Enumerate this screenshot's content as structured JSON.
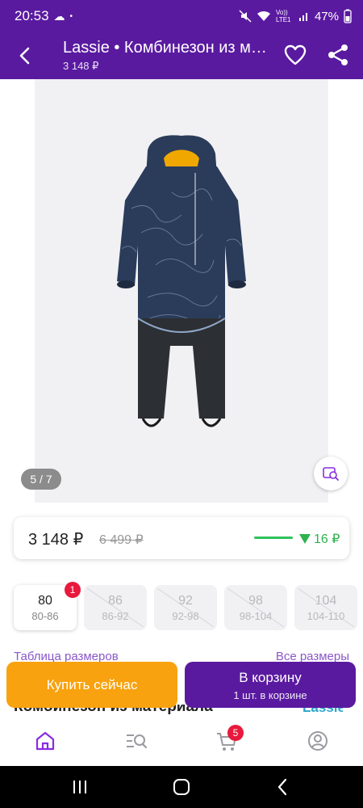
{
  "status_bar": {
    "time": "20:53",
    "network_label": "Vo)) LTE1",
    "battery": "47%"
  },
  "app_bar": {
    "title": "Lassie • Комбинезон из материала",
    "subtitle": "3 148 ₽"
  },
  "gallery": {
    "pager": "5 / 7",
    "colors": {
      "fabric": "#2b3c5a",
      "pants": "#2c2f33",
      "collar": "#f0a800"
    }
  },
  "price_card": {
    "current": "3 148 ₽",
    "old": "6 499 ₽",
    "drop": "16 ₽",
    "drop_color": "#2fb24f"
  },
  "sizes": [
    {
      "size": "80",
      "range": "80-86",
      "available": true,
      "selected": true,
      "badge": "1"
    },
    {
      "size": "86",
      "range": "86-92",
      "available": false
    },
    {
      "size": "92",
      "range": "92-98",
      "available": false
    },
    {
      "size": "98",
      "range": "98-104",
      "available": false
    },
    {
      "size": "104",
      "range": "104-110",
      "available": false
    }
  ],
  "links": {
    "size_table": "Таблица размеров",
    "all_sizes": "Все размеры"
  },
  "actions": {
    "buy_now": "Купить сейчас",
    "to_cart": "В корзину",
    "in_cart": "1 шт. в корзине"
  },
  "behind": {
    "product_title": "Комбинезон из материала",
    "brand": "Lassie"
  },
  "tab_bar": {
    "cart_badge": "5",
    "accent": "#8a2be2"
  }
}
